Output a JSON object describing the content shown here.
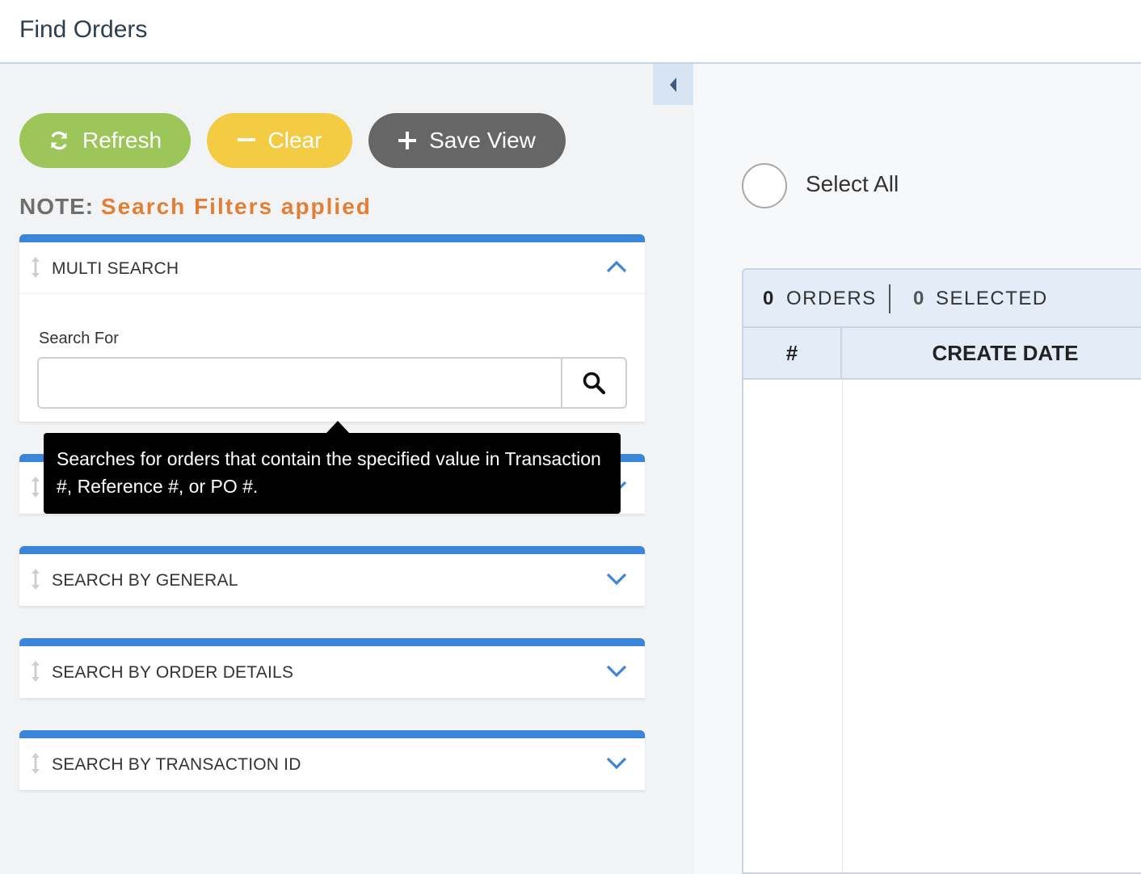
{
  "header": {
    "title": "Find Orders"
  },
  "toolbar": {
    "refresh_label": "Refresh",
    "clear_label": "Clear",
    "save_view_label": "Save View"
  },
  "note": {
    "label": "NOTE:",
    "text": "Search Filters applied"
  },
  "panels": {
    "multi_search": {
      "title": "MULTI SEARCH",
      "expanded": true,
      "field_label": "Search For",
      "search_value": "",
      "search_placeholder": ""
    },
    "general": {
      "title": "SEARCH BY GENERAL",
      "expanded": false
    },
    "order_details": {
      "title": "SEARCH BY ORDER DETAILS",
      "expanded": false
    },
    "transaction_id": {
      "title": "SEARCH BY TRANSACTION ID",
      "expanded": false
    }
  },
  "tooltip": {
    "text": "Searches for orders that contain the specified value in Transaction #, Reference #, or PO #."
  },
  "results": {
    "select_all_label": "Select All",
    "orders_count": "0",
    "orders_label": "ORDERS",
    "selected_count": "0",
    "selected_label": "SELECTED",
    "columns": [
      "#",
      "CREATE DATE"
    ]
  },
  "colors": {
    "refresh": "#9cc55a",
    "clear": "#f3cc44",
    "save_view": "#666666",
    "panel_accent": "#3d85d8",
    "note_highlight": "#e27f34"
  },
  "icons": {
    "collapse": "caret-left-icon",
    "refresh": "refresh-icon",
    "clear": "minus-icon",
    "save_view": "plus-icon",
    "drag": "drag-handle-icon",
    "expand": "chevron-up-icon",
    "collapsed": "chevron-down-icon",
    "search": "search-icon"
  }
}
